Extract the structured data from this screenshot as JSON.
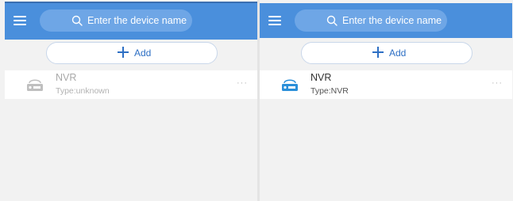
{
  "colors": {
    "header": "#4a8fdc",
    "search_bg": "#6ea6e6",
    "accent": "#2d6fc4",
    "device_icon_online": "#2a8fd9",
    "device_icon_offline": "#bfbfbf"
  },
  "panels": [
    {
      "menu_icon": "menu-icon",
      "search": {
        "icon": "search-icon",
        "placeholder": "Enter the device name"
      },
      "add_button": {
        "icon": "plus-icon",
        "label": "Add"
      },
      "devices": [
        {
          "name": "NVR",
          "type": "Type:unknown",
          "status": "offline",
          "icon": "nvr-device-icon",
          "more": "···"
        }
      ]
    },
    {
      "menu_icon": "menu-icon",
      "search": {
        "icon": "search-icon",
        "placeholder": "Enter the device name"
      },
      "add_button": {
        "icon": "plus-icon",
        "label": "Add"
      },
      "devices": [
        {
          "name": "NVR",
          "type": "Type:NVR",
          "status": "online",
          "icon": "nvr-device-icon",
          "more": "···"
        }
      ]
    }
  ]
}
